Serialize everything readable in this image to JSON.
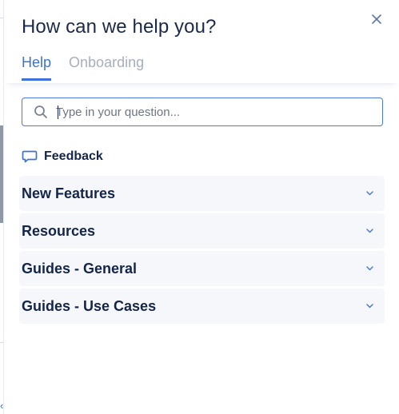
{
  "header": {
    "title": "How can we help you?",
    "close_icon": "close-icon"
  },
  "tabs": [
    {
      "label": "Help",
      "active": true
    },
    {
      "label": "Onboarding",
      "active": false
    }
  ],
  "search": {
    "placeholder": "Type in your question...",
    "value": "",
    "icon": "search-icon"
  },
  "feedback": {
    "label": "Feedback",
    "icon": "speech-bubble-icon"
  },
  "sections": [
    {
      "label": "New Features"
    },
    {
      "label": "Resources"
    },
    {
      "label": "Guides - General"
    },
    {
      "label": "Guides - Use Cases"
    }
  ],
  "colors": {
    "accent": "#3d73d9",
    "text_dark": "#14254a",
    "tab_inactive": "#a7afbe",
    "section_bg": "#f5f7fa"
  }
}
